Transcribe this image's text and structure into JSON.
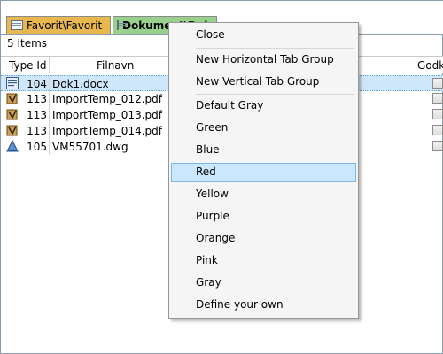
{
  "tabs": [
    {
      "label": "Favorit\\Favorit",
      "color": "#e8b84e",
      "icon": "document-tab-icon"
    },
    {
      "label": "Dokument\\Dokument",
      "color": "#98d08c",
      "icon": "document-tab-icon",
      "active": true
    }
  ],
  "status": {
    "items_count": "5 Items"
  },
  "columns": {
    "type_id": "Type Id",
    "filename": "Filnavn",
    "approved": "Godke"
  },
  "rows": [
    {
      "type_id": "104",
      "name": "Dok1.docx",
      "icon": "word-document-icon",
      "selected": true
    },
    {
      "type_id": "113",
      "name": "ImportTemp_012.pdf",
      "icon": "import-file-icon"
    },
    {
      "type_id": "113",
      "name": "ImportTemp_013.pdf",
      "icon": "import-file-icon"
    },
    {
      "type_id": "113",
      "name": "ImportTemp_014.pdf",
      "icon": "import-file-icon"
    },
    {
      "type_id": "105",
      "name": "VM55701.dwg",
      "icon": "drawing-file-icon"
    }
  ],
  "menu": {
    "items": [
      {
        "label": "Close"
      },
      {
        "label": "New Horizontal Tab Group"
      },
      {
        "label": "New Vertical Tab Group"
      },
      {
        "label": "Default Gray"
      },
      {
        "label": "Green"
      },
      {
        "label": "Blue"
      },
      {
        "label": "Red",
        "highlighted": true
      },
      {
        "label": "Yellow"
      },
      {
        "label": "Purple"
      },
      {
        "label": "Orange"
      },
      {
        "label": "Pink"
      },
      {
        "label": "Gray"
      },
      {
        "label": "Define your own"
      }
    ],
    "highlight_color": "#cce8ff"
  }
}
